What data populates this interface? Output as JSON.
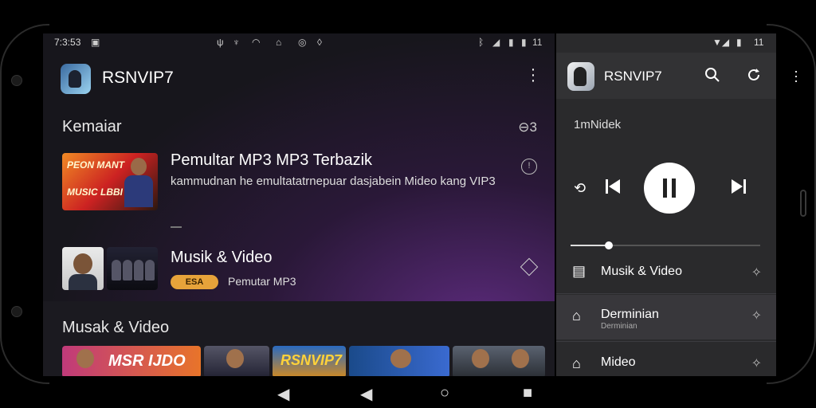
{
  "status_left": {
    "time": "7:3:53",
    "right_num": "11"
  },
  "status_right": {
    "right_num": "11"
  },
  "app": {
    "title": "RSNVIP7"
  },
  "section1": {
    "title": "Kemaiar"
  },
  "item1": {
    "title": "Pemultar MP3 MP3 Terbazik",
    "subtitle": "kammudnan he emultatatrnepuar dasjabein Mideo kang VIP3",
    "thumb_line1": "PEON MANT",
    "thumb_line2": "MUSIC LBBI"
  },
  "item2": {
    "title": "Musik & Video",
    "badge": "ESA",
    "badge_text": "Pemutar MP3"
  },
  "section2": {
    "title": "Musak & Video"
  },
  "strip": {
    "s1_text": "MSR IJDO",
    "s3_text": "RSNVIP7"
  },
  "panel": {
    "title": "RSNVIP7",
    "now_playing": "1mNidek",
    "progress": 0.2,
    "rows": [
      {
        "label": "Musik & Video",
        "sub": ""
      },
      {
        "label": "Derminian",
        "sub": "Derminian"
      },
      {
        "label": "Mideo",
        "sub": ""
      }
    ]
  },
  "icons": {
    "search": "search-icon",
    "refresh": "refresh-icon",
    "more": "more-vert-icon"
  }
}
